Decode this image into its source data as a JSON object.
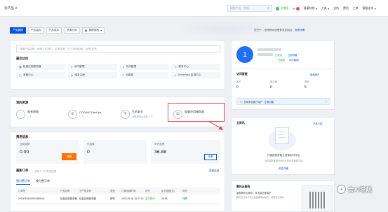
{
  "topbar": {
    "brand": "云产品",
    "search_placeholder": "搜索产品、文档、...",
    "nav": [
      "小程序",
      "消息",
      "备案待领",
      "工具",
      "支持",
      "费用",
      "工单",
      "客服支持"
    ],
    "msg_badge": "1",
    "todo_badge": "1"
  },
  "tabs": [
    "产品管理",
    "产品监控",
    "产品成本",
    "资源分析"
  ],
  "tabs_active": 0,
  "tab_manage": "管理面板",
  "search": {
    "placeholder": "搜索产品名称、地域、实例ID、实例名称、IP (公网/私网)、标签(标签)",
    "recent_title": "最近访问",
    "quick": [
      "轻量应用服务器",
      "访问管理",
      "访问管理",
      "账号中心",
      "消费中心",
      "域名注册",
      "云数据",
      "Serverless 应用中心"
    ]
  },
  "resources": {
    "title": "我的资源",
    "items": [
      {
        "name": "私有网络",
        "sub": "1 个"
      },
      {
        "name": "CODING DevOps",
        "sub": "1 个"
      },
      {
        "name": "主机安全",
        "sub": "待处理安全事件 0 个"
      },
      {
        "name": "轻量应用服务器",
        "sub": "1 个"
      }
    ]
  },
  "fees": {
    "title": "费用信息",
    "balance_label": "当前余额",
    "balance": "0.00",
    "recharge": "充值",
    "voucher_label": "代金券",
    "voucher": "0",
    "invoice_label": "可开发票",
    "invoice": "36.88",
    "invoice_btn": "开票",
    "orders_title": "最新订单",
    "orders_note": "您有 0 个订单待处理",
    "orders_all": "查看全部",
    "order_tabs": [
      "预付费订单",
      "按付费订单"
    ],
    "columns": [
      "订单号",
      "产品名称",
      "子产品名称",
      "类型",
      "订单创建时间",
      "状态",
      "实付金额(元)",
      "操作"
    ],
    "rows": [
      [
        "20230926009924380601",
        "轻量应用服务器",
        "轻量应用服务器",
        "新购",
        "2023-09-26 18:27:15",
        "支付成功",
        "36.88",
        "详情"
      ]
    ]
  },
  "account": {
    "avatar_letter": "1",
    "verify": "已实名",
    "mfa": "立即设置",
    "bind": "已绑定",
    "access_title": "访问管理",
    "new_user": "新增用户",
    "policy_link": "访问管理",
    "stats": [
      {
        "label": "用户",
        "value": "0"
      },
      {
        "label": "用户组",
        "value": "0"
      },
      {
        "label": "角色",
        "value": "5"
      }
    ],
    "notice_text": "您尚未创建子用户",
    "notice_link": "立即创建",
    "login_text": "您已于... 使用移动设备登录控制台，",
    "login_link": "查看详情"
  },
  "cloudspace": {
    "title": "云资讯",
    "more": "产品介绍",
    "empty": "开通即刻获取云资源实时评估",
    "desc": "为您智能推荐全局优化的资源管理方案",
    "link": "前往开通"
  },
  "news": {
    "title": "腾讯云服务",
    "line1": "使用腾讯云服务，将流量全程保护",
    "line2": "腾讯云针对于安全的数据保护能力，帮你安全防护"
  },
  "watermark": {
    "icon": "wechat-icon",
    "text": "会AI导航"
  },
  "colors": {
    "primary": "#0052d9",
    "orange": "#ff7200",
    "highlight": "#e34d59",
    "green": "#1aad19"
  }
}
